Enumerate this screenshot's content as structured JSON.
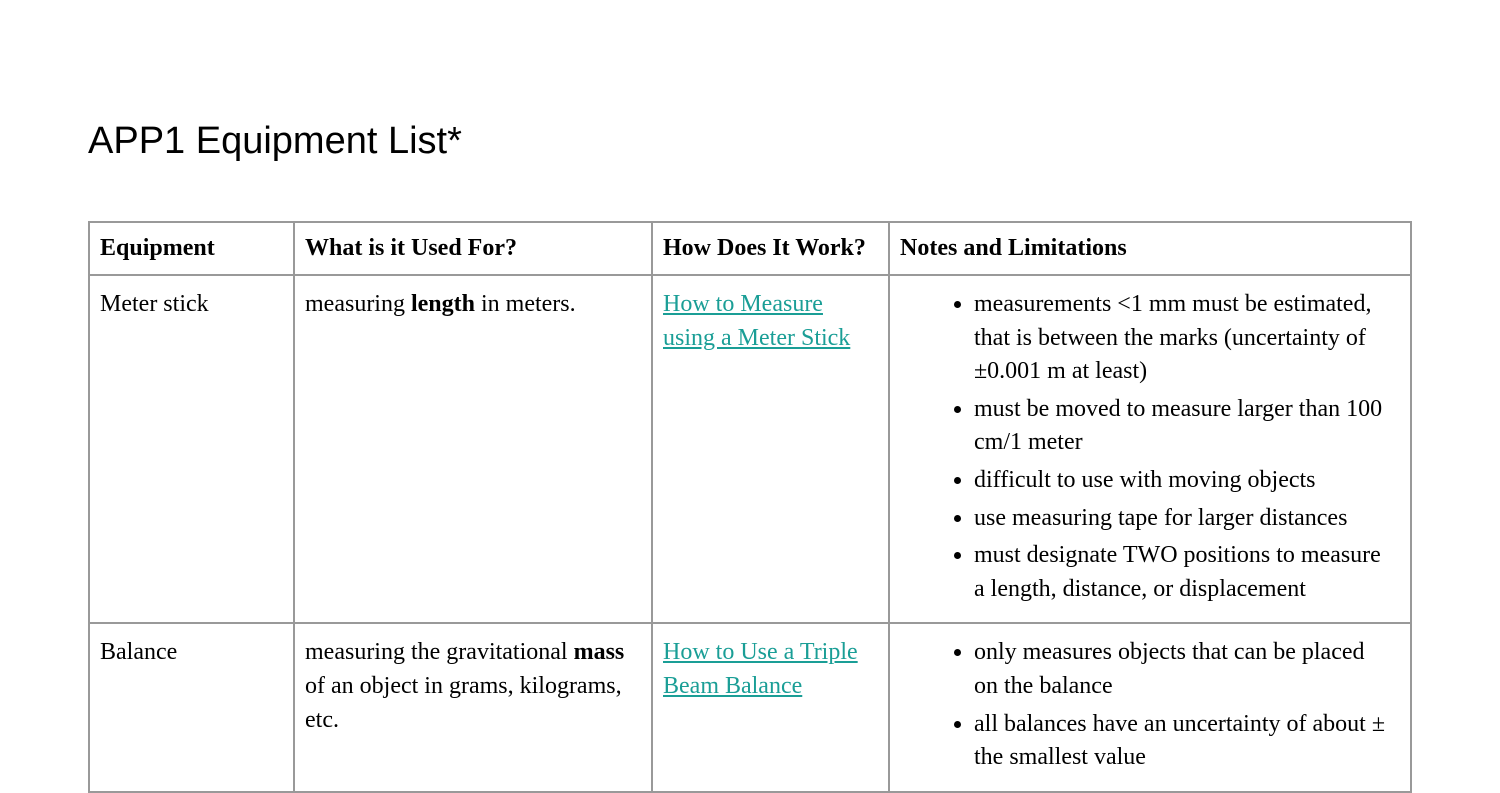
{
  "title": "APP1 Equipment List*",
  "headers": {
    "equipment": "Equipment",
    "used_for": "What is it Used For?",
    "how_works": "How Does It Work?",
    "notes": "Notes and Limitations"
  },
  "rows": [
    {
      "equipment": "Meter stick",
      "used_prefix": "measuring ",
      "used_bold": "length",
      "used_suffix": " in meters.",
      "link_text": "How to Measure using a Meter Stick",
      "notes": [
        "measurements <1 mm must be estimated, that is between the marks (uncertainty of ±0.001 m at least)",
        "must be moved to measure larger than 100 cm/1 meter",
        "difficult to use with moving objects",
        "use measuring tape for larger distances",
        "must designate TWO positions to measure a length, distance, or displacement"
      ]
    },
    {
      "equipment": "Balance",
      "used_prefix": "measuring the gravitational ",
      "used_bold": "mass",
      "used_suffix": " of an object in grams, kilograms, etc.",
      "link_text": "How to Use a Triple Beam Balance",
      "notes": [
        "only measures objects that can be placed on the balance",
        "all balances have an uncertainty of about ± the smallest value"
      ]
    }
  ]
}
